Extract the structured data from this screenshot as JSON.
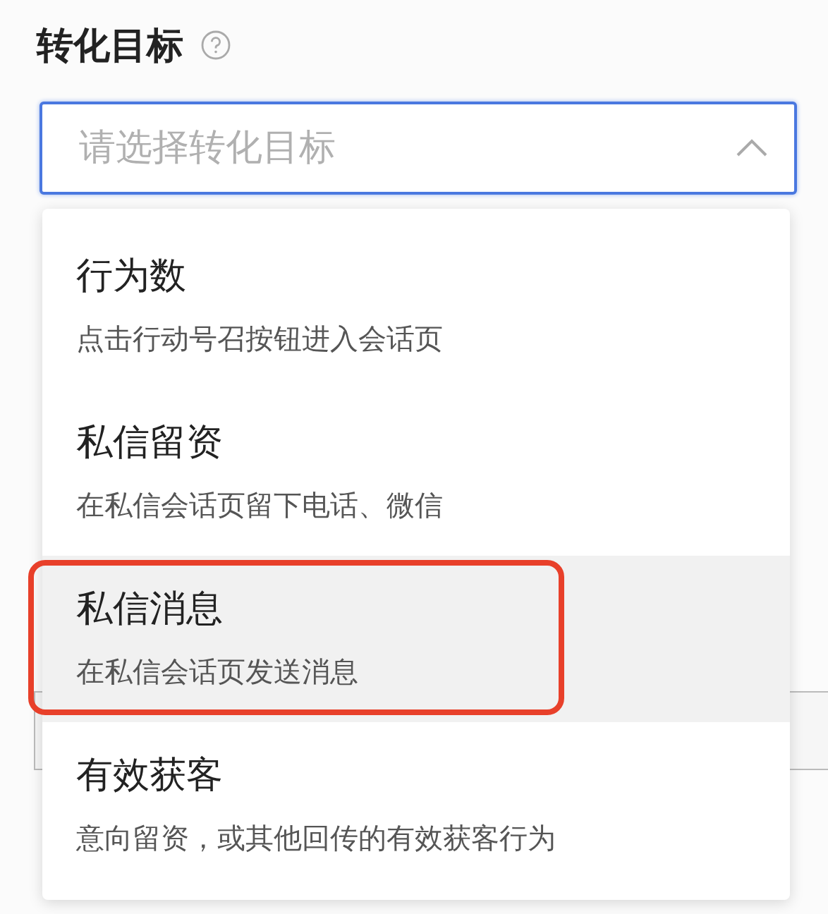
{
  "field": {
    "label": "转化目标",
    "placeholder": "请选择转化目标",
    "expanded": true
  },
  "options": [
    {
      "title": "行为数",
      "description": "点击行动号召按钮进入会话页",
      "hovered": false,
      "annotated": false
    },
    {
      "title": "私信留资",
      "description": "在私信会话页留下电话、微信",
      "hovered": false,
      "annotated": false
    },
    {
      "title": "私信消息",
      "description": "在私信会话页发送消息",
      "hovered": true,
      "annotated": true
    },
    {
      "title": "有效获客",
      "description": "意向留资，或其他回传的有效获客行为",
      "hovered": false,
      "annotated": false
    }
  ]
}
